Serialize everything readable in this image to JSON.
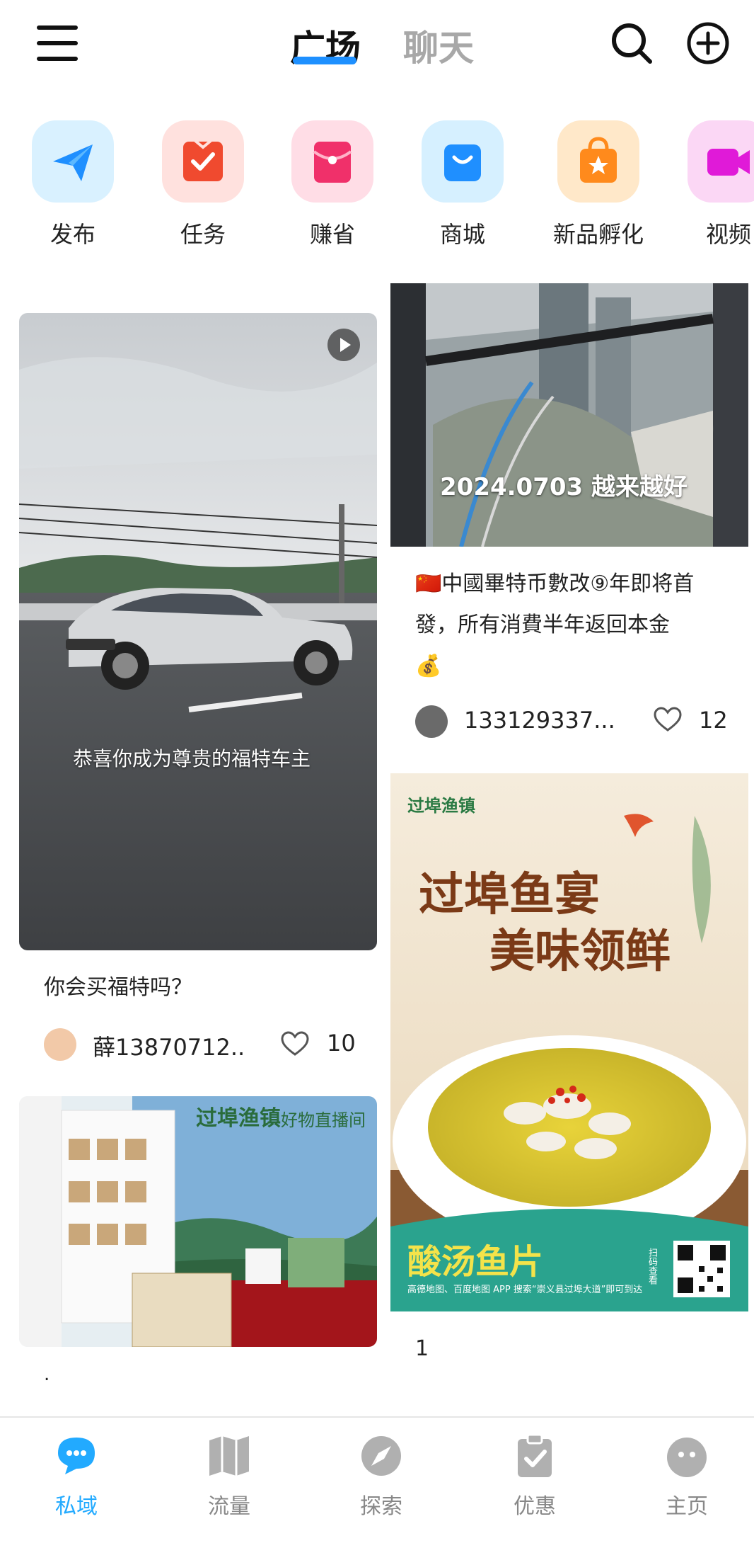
{
  "header": {
    "tabs": [
      "广场",
      "聊天"
    ]
  },
  "shortcuts": [
    {
      "label": "发布",
      "icon": "paper-plane-icon",
      "bg": "#d9f1ff",
      "color": "#1f8fff"
    },
    {
      "label": "任务",
      "icon": "task-check-icon",
      "bg": "#ffe1de",
      "color": "#f04a2f"
    },
    {
      "label": "赚省",
      "icon": "red-envelope-icon",
      "bg": "#ffdde6",
      "color": "#f0306a"
    },
    {
      "label": "商城",
      "icon": "shopping-bag-icon",
      "bg": "#d6f0ff",
      "color": "#1f8fff"
    },
    {
      "label": "新品孵化",
      "icon": "gift-bag-icon",
      "bg": "#ffe8c9",
      "color": "#ff8a1c"
    },
    {
      "label": "视频",
      "icon": "video-camera-icon",
      "bg": "#fbd7f5",
      "color": "#e01ad8"
    }
  ],
  "feed": {
    "left": [
      {
        "overlay_caption": "恭喜你成为尊贵的福特车主",
        "title": "你会买福特吗？",
        "user": "薛13870712..",
        "likes": "10",
        "has_video": true
      },
      {
        "sign_text": "过埠渔镇",
        "sign_text_2": "好物直播间",
        "title": "."
      }
    ],
    "right": [
      {
        "overlay_caption": "2024.0703 越来越好",
        "title_flag": "🇨🇳",
        "title": "中國畢特币數改⑨年即将首發，所有消費半年返回本金",
        "title_emoji": "💰",
        "user": "133129337...",
        "likes": "12"
      },
      {
        "poster_logo": "过埠渔镇",
        "poster_headline_1": "过埠鱼宴",
        "poster_headline_2": "美味领鲜",
        "poster_dish": "酸汤鱼片",
        "poster_footnote": "高德地图、百度地图 APP 搜索“崇义县过埠大道”即可到达",
        "poster_qr_note": "扫码查看",
        "title": "1"
      }
    ]
  },
  "bottom_nav": [
    {
      "label": "私域",
      "icon": "chat-bubble-icon",
      "active": true
    },
    {
      "label": "流量",
      "icon": "map-icon",
      "active": false
    },
    {
      "label": "探索",
      "icon": "compass-icon",
      "active": false
    },
    {
      "label": "优惠",
      "icon": "clipboard-check-icon",
      "active": false
    },
    {
      "label": "主页",
      "icon": "profile-face-icon",
      "active": false
    }
  ],
  "colors": {
    "accent": "#1e90ff",
    "nav_active": "#22aaff",
    "nav_inactive": "#b0b0b0"
  }
}
